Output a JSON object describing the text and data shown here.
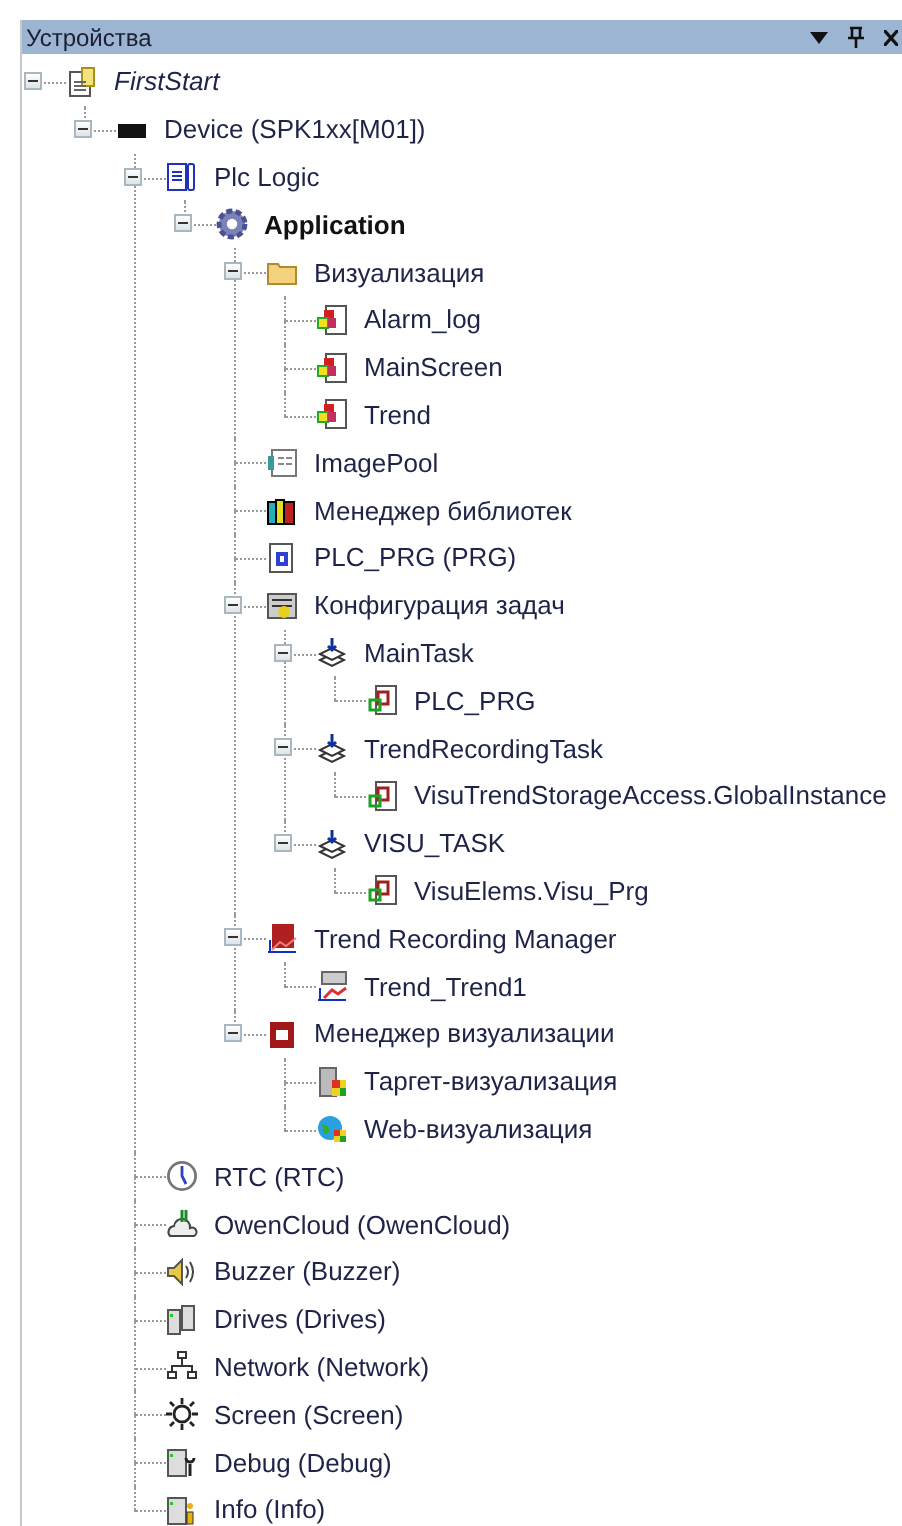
{
  "panel": {
    "title": "Устройства"
  },
  "tree": [
    {
      "label": "FirstStart",
      "kind": "project",
      "expanded": true,
      "children": [
        {
          "label": "Device (SPK1xx[M01])",
          "kind": "device",
          "expanded": true,
          "children": [
            {
              "label": "Plc Logic",
              "kind": "plc",
              "expanded": true,
              "children": [
                {
                  "label": "Application",
                  "kind": "gear",
                  "expanded": true,
                  "children": [
                    {
                      "label": "Визуализация",
                      "kind": "folder",
                      "expanded": true,
                      "children": [
                        {
                          "label": "Alarm_log",
                          "kind": "visu"
                        },
                        {
                          "label": "MainScreen",
                          "kind": "visu"
                        },
                        {
                          "label": "Trend",
                          "kind": "visu"
                        }
                      ]
                    },
                    {
                      "label": "ImagePool",
                      "kind": "imagepool"
                    },
                    {
                      "label": "Менеджер библиотек",
                      "kind": "library"
                    },
                    {
                      "label": "PLC_PRG (PRG)",
                      "kind": "prg"
                    },
                    {
                      "label": "Конфигурация задач",
                      "kind": "taskconfig",
                      "expanded": true,
                      "children": [
                        {
                          "label": "MainTask",
                          "kind": "task",
                          "expanded": true,
                          "children": [
                            {
                              "label": "PLC_PRG",
                              "kind": "call"
                            }
                          ]
                        },
                        {
                          "label": "TrendRecordingTask",
                          "kind": "task",
                          "expanded": true,
                          "children": [
                            {
                              "label": "VisuTrendStorageAccess.GlobalInstance",
                              "kind": "call"
                            }
                          ]
                        },
                        {
                          "label": "VISU_TASK",
                          "kind": "task",
                          "expanded": true,
                          "children": [
                            {
                              "label": "VisuElems.Visu_Prg",
                              "kind": "call"
                            }
                          ]
                        }
                      ]
                    },
                    {
                      "label": "Trend Recording Manager",
                      "kind": "trendmgr",
                      "expanded": true,
                      "children": [
                        {
                          "label": "Trend_Trend1",
                          "kind": "trend"
                        }
                      ]
                    },
                    {
                      "label": "Менеджер визуализации",
                      "kind": "visumgr",
                      "expanded": true,
                      "children": [
                        {
                          "label": "Таргет-визуализация",
                          "kind": "targetvisu"
                        },
                        {
                          "label": "Web-визуализация",
                          "kind": "webvisu"
                        }
                      ]
                    }
                  ]
                }
              ]
            },
            {
              "label": "RTC (RTC)",
              "kind": "clock"
            },
            {
              "label": "OwenCloud (OwenCloud)",
              "kind": "cloud"
            },
            {
              "label": "Buzzer (Buzzer)",
              "kind": "speaker"
            },
            {
              "label": "Drives (Drives)",
              "kind": "drives"
            },
            {
              "label": "Network (Network)",
              "kind": "network"
            },
            {
              "label": "Screen (Screen)",
              "kind": "sun"
            },
            {
              "label": "Debug (Debug)",
              "kind": "debug"
            },
            {
              "label": "Info (Info)",
              "kind": "info"
            }
          ]
        }
      ]
    }
  ]
}
